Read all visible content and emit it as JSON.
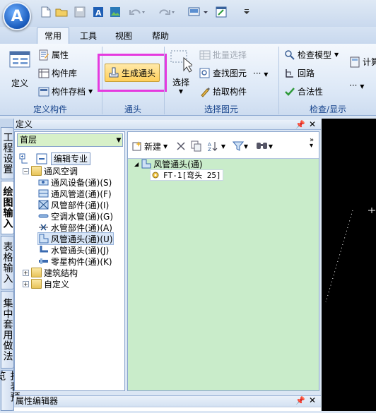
{
  "app": {
    "logo_letter": "A"
  },
  "quick_access": [
    "new-file-icon",
    "open-icon",
    "save-icon",
    "a-icon",
    "image-icon",
    "undo-icon",
    "redo-icon",
    "monitor-icon",
    "window-icon",
    "dropdown-icon"
  ],
  "tabs": [
    {
      "label": "常用",
      "active": true
    },
    {
      "label": "工具",
      "active": false
    },
    {
      "label": "视图",
      "active": false
    },
    {
      "label": "帮助",
      "active": false
    }
  ],
  "ribbon": {
    "define_group": {
      "define_label": "定义",
      "attribute_label": "属性",
      "component_lib_label": "构件库",
      "component_save_label": "构件存档",
      "group_label": "定义构件"
    },
    "fitting_group": {
      "generate_label": "生成通头",
      "group_label": "通头"
    },
    "select_group": {
      "select_label": "选择",
      "batch_select_label": "批量选择",
      "find_label": "查找图元",
      "pick_label": "拾取构件",
      "group_label": "选择图元"
    },
    "check_group": {
      "check_model_label": "检查模型",
      "loop_label": "回路",
      "legal_label": "合法性",
      "calc_label": "计算",
      "group_label": "检查/显示"
    }
  },
  "left_tabs": [
    "工程设置",
    "绘图输入",
    "表格输入",
    "集中套用做法",
    "报表预览"
  ],
  "panel": {
    "title": "定义"
  },
  "floor": {
    "value": "首层"
  },
  "left_toolbar": {
    "edit_pro_label": "编辑专业"
  },
  "tree": [
    {
      "label": "通风空调",
      "level": 0,
      "expanded": true,
      "icon": "folder-open-icon"
    },
    {
      "label": "通风设备(通)(S)",
      "level": 1,
      "icon": "fan-device-icon"
    },
    {
      "label": "通风管道(通)(F)",
      "level": 1,
      "icon": "duct-icon"
    },
    {
      "label": "风管部件(通)(I)",
      "level": 1,
      "icon": "duct-part-icon"
    },
    {
      "label": "空调水管(通)(G)",
      "level": 1,
      "icon": "water-pipe-icon"
    },
    {
      "label": "水管部件(通)(A)",
      "level": 1,
      "icon": "valve-icon"
    },
    {
      "label": "风管通头(通)(U)",
      "level": 1,
      "icon": "duct-fitting-icon",
      "selected": true
    },
    {
      "label": "水管通头(通)(J)",
      "level": 1,
      "icon": "pipe-fitting-icon"
    },
    {
      "label": "零星构件(通)(K)",
      "level": 1,
      "icon": "misc-part-icon"
    },
    {
      "label": "建筑结构",
      "level": 0,
      "expanded": false,
      "icon": "folder-icon"
    },
    {
      "label": "自定义",
      "level": 0,
      "expanded": false,
      "icon": "folder-icon"
    }
  ],
  "right_toolbar": {
    "new_label": "新建"
  },
  "component_list": {
    "root_label": "风管通头(通)",
    "child_label": "FT-1[弯头 25]"
  },
  "properties": {
    "title": "属性编辑器"
  }
}
